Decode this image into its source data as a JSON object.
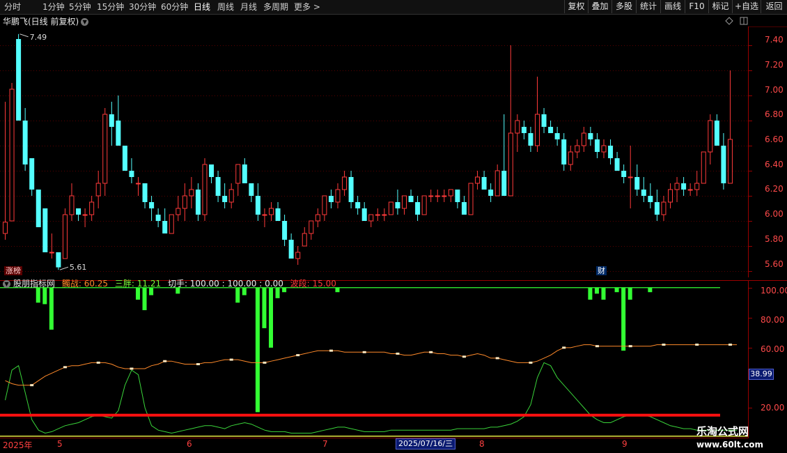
{
  "toolbar": {
    "periods": [
      "分时",
      "1分钟",
      "5分钟",
      "15分钟",
      "30分钟",
      "60分钟",
      "日线",
      "周线",
      "月线",
      "多周期",
      "更多 >"
    ],
    "active_period": "日线",
    "right_buttons": [
      "复权",
      "叠加",
      "多股",
      "统计",
      "画线",
      "F10",
      "标记",
      "+自选",
      "返回"
    ]
  },
  "stock": {
    "name": "华鹏飞(日线 前复权)"
  },
  "indicator": {
    "name": "股朋指标网",
    "items": [
      {
        "label": "髑战: 60.25",
        "color": "#ff8a2a"
      },
      {
        "label": "三胖: 11.21",
        "color": "#7cff3a"
      },
      {
        "label": "切手: 100.00 : 100.00 : 0.00",
        "color": "#f0f0f0"
      },
      {
        "label": "波段: 15.00",
        "color": "#ff3a3a"
      }
    ],
    "value_box": "38.99",
    "axis": [
      "100.00",
      "80.00",
      "60.00",
      "20.00"
    ]
  },
  "badges": {
    "zhangbang": "涨榜",
    "cai": "财"
  },
  "price": {
    "high_label": "7.49",
    "low_label": "5.61",
    "axis": [
      "7.40",
      "7.20",
      "7.00",
      "6.80",
      "6.60",
      "6.40",
      "6.20",
      "6.00",
      "5.80",
      "5.60"
    ]
  },
  "dates": {
    "labels": [
      "2025年",
      "5",
      "6",
      "7",
      "8",
      "9"
    ],
    "tooltip": "2025/07/16/三"
  },
  "watermark": {
    "name": "乐淘公式网",
    "url": "www.60lt.com"
  },
  "colors": {
    "up": "#ff3a3a",
    "down": "#54ffff",
    "green": "#33ff33",
    "orange": "#ff8a2a",
    "red": "#ff1010"
  },
  "chart_data": [
    {
      "type": "candlestick",
      "title": "华鹏飞(日线 前复权)",
      "ylim": [
        5.55,
        7.55
      ],
      "axis_ticks": [
        7.4,
        7.2,
        7.0,
        6.8,
        6.6,
        6.4,
        6.2,
        6.0,
        5.8,
        5.6
      ],
      "annotations": [
        {
          "label": "7.49",
          "value": 7.49
        },
        {
          "label": "5.61",
          "value": 5.61
        }
      ],
      "ohlc": [
        [
          5.9,
          6.95,
          5.85,
          5.99
        ],
        [
          6.0,
          7.1,
          6.0,
          7.05
        ],
        [
          7.45,
          7.49,
          6.8,
          6.8
        ],
        [
          6.8,
          6.9,
          6.4,
          6.45
        ],
        [
          6.5,
          6.5,
          6.2,
          6.25
        ],
        [
          6.25,
          6.25,
          5.95,
          5.95
        ],
        [
          6.1,
          6.1,
          5.75,
          5.75
        ],
        [
          5.75,
          5.9,
          5.7,
          5.75
        ],
        [
          5.75,
          5.75,
          5.61,
          5.63
        ],
        [
          5.7,
          6.1,
          5.7,
          6.05
        ],
        [
          6.05,
          6.3,
          6.0,
          6.2
        ],
        [
          6.1,
          6.1,
          6.0,
          6.05
        ],
        [
          6.05,
          6.1,
          5.95,
          6.05
        ],
        [
          6.05,
          6.2,
          6.0,
          6.15
        ],
        [
          6.2,
          6.4,
          6.1,
          6.3
        ],
        [
          6.3,
          6.9,
          6.2,
          6.85
        ],
        [
          6.85,
          6.95,
          6.6,
          6.75
        ],
        [
          6.8,
          7.0,
          6.6,
          6.6
        ],
        [
          6.6,
          6.6,
          6.4,
          6.4
        ],
        [
          6.4,
          6.5,
          6.3,
          6.35
        ],
        [
          6.3,
          6.35,
          6.2,
          6.3
        ],
        [
          6.3,
          6.3,
          6.1,
          6.15
        ],
        [
          6.15,
          6.2,
          6.0,
          6.1
        ],
        [
          6.05,
          6.1,
          5.95,
          6.0
        ],
        [
          6.0,
          6.1,
          5.9,
          5.9
        ],
        [
          5.9,
          6.05,
          5.9,
          6.05
        ],
        [
          6.05,
          6.2,
          6.0,
          6.1
        ],
        [
          6.1,
          6.3,
          6.0,
          6.2
        ],
        [
          6.2,
          6.35,
          6.1,
          6.25
        ],
        [
          6.25,
          6.3,
          6.0,
          6.05
        ],
        [
          6.05,
          6.5,
          6.0,
          6.45
        ],
        [
          6.45,
          6.45,
          6.3,
          6.35
        ],
        [
          6.35,
          6.4,
          6.15,
          6.2
        ],
        [
          6.2,
          6.3,
          6.1,
          6.15
        ],
        [
          6.15,
          6.3,
          6.1,
          6.25
        ],
        [
          6.3,
          6.45,
          6.2,
          6.45
        ],
        [
          6.45,
          6.5,
          6.3,
          6.3
        ],
        [
          6.3,
          6.3,
          6.15,
          6.2
        ],
        [
          6.2,
          6.3,
          6.0,
          6.05
        ],
        [
          6.05,
          6.1,
          5.95,
          6.05
        ],
        [
          6.05,
          6.15,
          6.0,
          6.1
        ],
        [
          6.1,
          6.15,
          6.0,
          6.0
        ],
        [
          6.0,
          6.05,
          5.8,
          5.85
        ],
        [
          5.85,
          5.9,
          5.7,
          5.7
        ],
        [
          5.7,
          5.8,
          5.65,
          5.75
        ],
        [
          5.8,
          5.95,
          5.8,
          5.9
        ],
        [
          5.9,
          6.0,
          5.85,
          6.0
        ],
        [
          6.0,
          6.1,
          5.95,
          6.05
        ],
        [
          6.05,
          6.2,
          6.0,
          6.2
        ],
        [
          6.2,
          6.25,
          6.1,
          6.15
        ],
        [
          6.15,
          6.3,
          6.1,
          6.25
        ],
        [
          6.25,
          6.4,
          6.2,
          6.35
        ],
        [
          6.35,
          6.4,
          6.1,
          6.15
        ],
        [
          6.15,
          6.2,
          6.05,
          6.1
        ],
        [
          6.1,
          6.15,
          6.0,
          6.0
        ],
        [
          6.0,
          6.05,
          5.95,
          6.05
        ],
        [
          6.05,
          6.1,
          6.0,
          6.05
        ],
        [
          6.05,
          6.1,
          6.0,
          6.05
        ],
        [
          6.05,
          6.15,
          6.05,
          6.15
        ],
        [
          6.15,
          6.25,
          6.05,
          6.1
        ],
        [
          6.1,
          6.2,
          6.05,
          6.2
        ],
        [
          6.2,
          6.25,
          6.15,
          6.15
        ],
        [
          6.15,
          6.2,
          6.0,
          6.05
        ],
        [
          6.05,
          6.2,
          6.05,
          6.2
        ],
        [
          6.2,
          6.25,
          6.15,
          6.2
        ],
        [
          6.2,
          6.25,
          6.15,
          6.2
        ],
        [
          6.2,
          6.25,
          6.15,
          6.2
        ],
        [
          6.2,
          6.25,
          6.15,
          6.25
        ],
        [
          6.25,
          6.25,
          6.1,
          6.15
        ],
        [
          6.15,
          6.2,
          6.05,
          6.05
        ],
        [
          6.05,
          6.3,
          6.05,
          6.3
        ],
        [
          6.3,
          6.4,
          6.25,
          6.35
        ],
        [
          6.35,
          6.4,
          6.25,
          6.25
        ],
        [
          6.25,
          6.3,
          6.15,
          6.2
        ],
        [
          6.2,
          6.45,
          6.2,
          6.4
        ],
        [
          6.4,
          6.85,
          6.2,
          6.2
        ],
        [
          6.2,
          7.4,
          6.2,
          6.7
        ],
        [
          6.7,
          6.85,
          6.55,
          6.8
        ],
        [
          6.75,
          6.8,
          6.65,
          6.7
        ],
        [
          6.7,
          6.75,
          6.55,
          6.6
        ],
        [
          6.6,
          7.15,
          6.55,
          6.85
        ],
        [
          6.85,
          6.9,
          6.7,
          6.75
        ],
        [
          6.75,
          6.8,
          6.7,
          6.7
        ],
        [
          6.7,
          6.75,
          6.6,
          6.65
        ],
        [
          6.65,
          6.7,
          6.4,
          6.45
        ],
        [
          6.45,
          6.6,
          6.4,
          6.55
        ],
        [
          6.55,
          6.65,
          6.5,
          6.6
        ],
        [
          6.6,
          6.75,
          6.55,
          6.7
        ],
        [
          6.7,
          6.75,
          6.6,
          6.65
        ],
        [
          6.65,
          6.7,
          6.5,
          6.55
        ],
        [
          6.55,
          6.65,
          6.5,
          6.6
        ],
        [
          6.6,
          6.65,
          6.45,
          6.5
        ],
        [
          6.5,
          6.55,
          6.4,
          6.4
        ],
        [
          6.4,
          6.45,
          6.3,
          6.35
        ],
        [
          6.35,
          6.6,
          6.1,
          6.35
        ],
        [
          6.35,
          6.45,
          6.2,
          6.25
        ],
        [
          6.25,
          6.35,
          6.15,
          6.2
        ],
        [
          6.2,
          6.3,
          6.1,
          6.15
        ],
        [
          6.15,
          6.25,
          6.0,
          6.05
        ],
        [
          6.05,
          6.2,
          6.0,
          6.15
        ],
        [
          6.15,
          6.3,
          6.1,
          6.25
        ],
        [
          6.25,
          6.35,
          6.15,
          6.3
        ],
        [
          6.3,
          6.35,
          6.2,
          6.25
        ],
        [
          6.25,
          6.3,
          6.2,
          6.25
        ],
        [
          6.25,
          6.4,
          6.2,
          6.3
        ],
        [
          6.3,
          6.55,
          6.3,
          6.55
        ],
        [
          6.55,
          6.85,
          6.45,
          6.8
        ],
        [
          6.8,
          6.85,
          6.6,
          6.6
        ],
        [
          6.6,
          6.7,
          6.25,
          6.3
        ],
        [
          6.3,
          7.2,
          6.3,
          6.65
        ]
      ]
    },
    {
      "type": "line",
      "title": "股朋指标网",
      "ylim": [
        0,
        105
      ],
      "axis_ticks": [
        100,
        80,
        60,
        20
      ],
      "series": [
        {
          "name": "髑战",
          "values": [
            38,
            36,
            35,
            35,
            35,
            38,
            41,
            43,
            45,
            47,
            48,
            48,
            49,
            50,
            50,
            50,
            49,
            47,
            46,
            46,
            46,
            46,
            48,
            49,
            51,
            51,
            50,
            49,
            49,
            49,
            50,
            50,
            51,
            52,
            52,
            52,
            51,
            50,
            50,
            50,
            51,
            52,
            53,
            54,
            55,
            56,
            57,
            58,
            58,
            58,
            58,
            57,
            57,
            57,
            57,
            57,
            57,
            57,
            56,
            56,
            55,
            55,
            56,
            57,
            57,
            56,
            56,
            55,
            55,
            54,
            55,
            56,
            55,
            53,
            53,
            52,
            51,
            50,
            50,
            50,
            51,
            53,
            55,
            58,
            60,
            60,
            61,
            62,
            62,
            61,
            61,
            61,
            61,
            61,
            61,
            61,
            61,
            61,
            62,
            62,
            62,
            62,
            62,
            62,
            62,
            62,
            62,
            62,
            62,
            62,
            62
          ]
        },
        {
          "name": "三胖",
          "values": [
            25,
            45,
            48,
            30,
            12,
            5,
            3,
            4,
            6,
            8,
            9,
            10,
            12,
            14,
            15,
            14,
            13,
            18,
            35,
            45,
            42,
            20,
            8,
            5,
            4,
            3,
            4,
            5,
            6,
            7,
            8,
            8,
            7,
            6,
            8,
            9,
            10,
            9,
            7,
            5,
            4,
            4,
            4,
            3,
            3,
            3,
            3,
            4,
            5,
            6,
            7,
            7,
            6,
            5,
            4,
            4,
            4,
            4,
            5,
            5,
            5,
            5,
            5,
            5,
            5,
            5,
            5,
            5,
            6,
            6,
            6,
            6,
            6,
            7,
            7,
            8,
            9,
            11,
            14,
            22,
            40,
            50,
            48,
            40,
            35,
            30,
            25,
            20,
            15,
            12,
            10,
            10,
            12,
            14,
            15,
            15,
            15,
            14,
            12,
            10,
            8,
            7,
            6,
            6,
            5,
            5,
            5,
            5,
            5,
            5,
            5
          ]
        },
        {
          "name": "切手",
          "values": [
            100
          ]
        },
        {
          "name": "波段",
          "values": [
            15
          ]
        }
      ],
      "bars": [
        {
          "i": 5,
          "v": 90
        },
        {
          "i": 6,
          "v": 89
        },
        {
          "i": 7,
          "v": 72
        },
        {
          "i": 20,
          "v": 92
        },
        {
          "i": 21,
          "v": 85
        },
        {
          "i": 22,
          "v": 95
        },
        {
          "i": 26,
          "v": 96
        },
        {
          "i": 35,
          "v": 90
        },
        {
          "i": 36,
          "v": 95
        },
        {
          "i": 38,
          "v": 17
        },
        {
          "i": 39,
          "v": 73
        },
        {
          "i": 40,
          "v": 60
        },
        {
          "i": 41,
          "v": 93
        },
        {
          "i": 42,
          "v": 97
        },
        {
          "i": 50,
          "v": 97
        },
        {
          "i": 88,
          "v": 92
        },
        {
          "i": 89,
          "v": 96
        },
        {
          "i": 90,
          "v": 92
        },
        {
          "i": 92,
          "v": 97
        },
        {
          "i": 93,
          "v": 58
        },
        {
          "i": 94,
          "v": 92
        },
        {
          "i": 97,
          "v": 97
        }
      ]
    }
  ]
}
